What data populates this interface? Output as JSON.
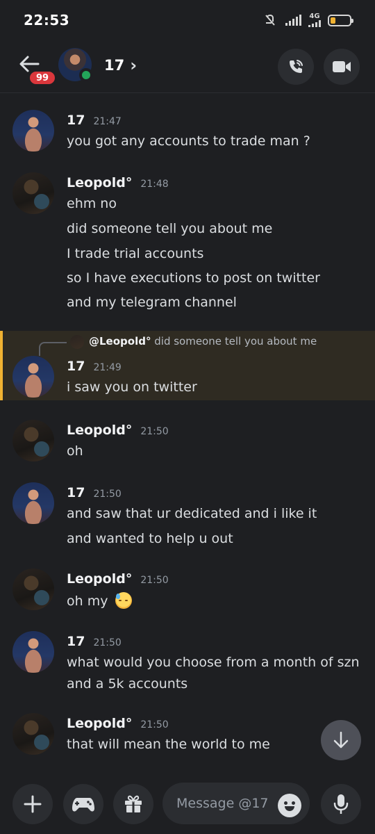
{
  "status_bar": {
    "time": "22:53",
    "network": "4G"
  },
  "header": {
    "back_badge": "99",
    "title": "17",
    "chevron": "›"
  },
  "messages": [
    {
      "author": "17",
      "time": "21:47",
      "lines": [
        "you got any accounts to trade man ?"
      ]
    },
    {
      "author": "Leopold°",
      "time": "21:48",
      "lines": [
        "ehm no",
        "did someone tell you about me",
        "I trade trial accounts",
        "so I have executions to post on twitter",
        "and my telegram channel"
      ]
    },
    {
      "author": "17",
      "time": "21:49",
      "reply": {
        "author": "@Leopold°",
        "text": "did someone tell you about me"
      },
      "lines": [
        "i saw you on twitter"
      ]
    },
    {
      "author": "Leopold°",
      "time": "21:50",
      "lines": [
        "oh"
      ]
    },
    {
      "author": "17",
      "time": "21:50",
      "lines": [
        "and saw that ur dedicated and i like it",
        "and wanted to help u out"
      ]
    },
    {
      "author": "Leopold°",
      "time": "21:50",
      "lines": [
        "oh my"
      ],
      "emoji": "downcast-face-with-sweat"
    },
    {
      "author": "17",
      "time": "21:50",
      "lines": [
        "what would you choose from a month of szn",
        "and a 5k accounts"
      ]
    },
    {
      "author": "Leopold°",
      "time": "21:50",
      "lines": [
        "that will mean the world to me"
      ]
    }
  ],
  "composer": {
    "placeholder": "Message @17"
  },
  "colors": {
    "background": "#1e1f22",
    "accent_reply": "#f0b232",
    "online": "#23a55a",
    "badge": "#da373c"
  }
}
